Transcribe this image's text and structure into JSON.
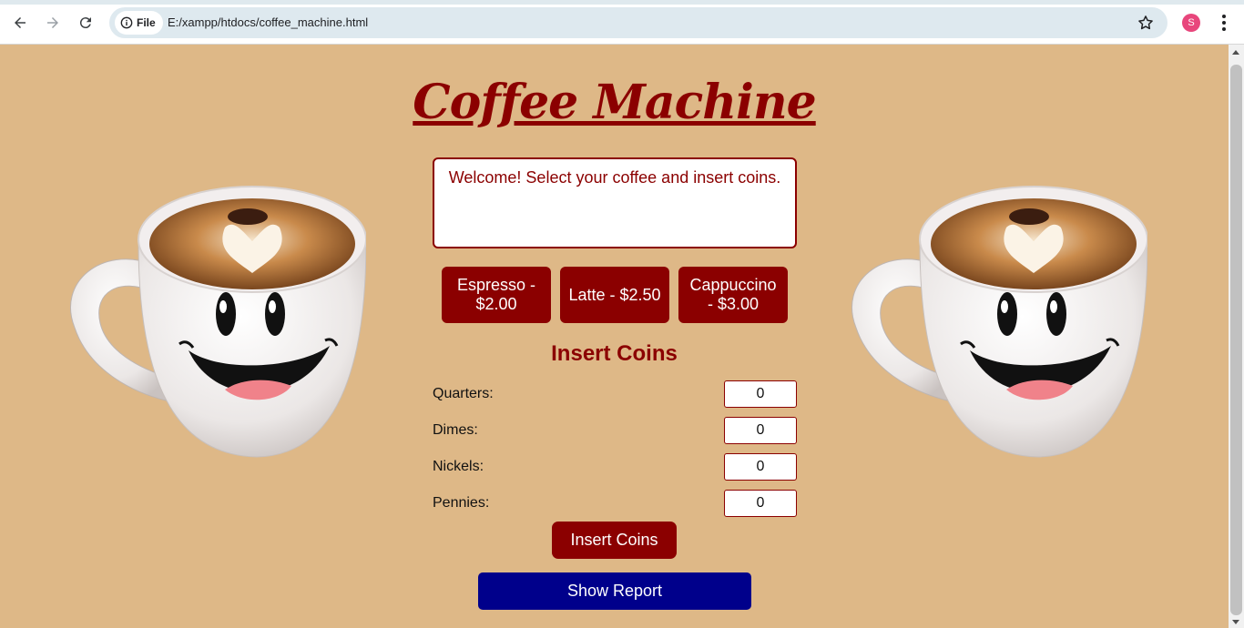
{
  "browser": {
    "nav": {
      "back_icon": "arrow-left-icon",
      "forward_icon": "arrow-right-icon",
      "reload_icon": "reload-icon"
    },
    "address_bar": {
      "chip_label": "File",
      "url": "E:/xampp/htdocs/coffee_machine.html"
    },
    "profile_initial": "S"
  },
  "page": {
    "title": "Coffee Machine",
    "display_message": "Welcome! Select your coffee and insert coins.",
    "coffees": [
      {
        "label": "Espresso - $2.00"
      },
      {
        "label": "Latte - $2.50"
      },
      {
        "label": "Cappuccino - $3.00"
      }
    ],
    "coins_heading": "Insert Coins",
    "coins": [
      {
        "label": "Quarters:",
        "value": "0"
      },
      {
        "label": "Dimes:",
        "value": "0"
      },
      {
        "label": "Nickels:",
        "value": "0"
      },
      {
        "label": "Pennies:",
        "value": "0"
      }
    ],
    "insert_button": "Insert Coins",
    "report_button": "Show Report"
  },
  "colors": {
    "background": "#deb887",
    "accent": "#8b0000",
    "report_button": "#00008b"
  },
  "images": [
    "smiling-coffee-mug-image",
    "smiling-coffee-mug-image"
  ]
}
